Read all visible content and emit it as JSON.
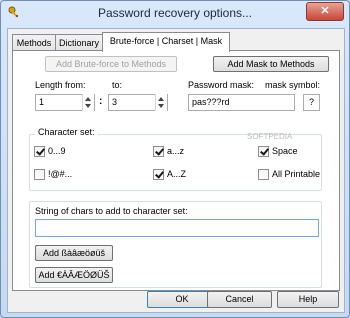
{
  "window": {
    "title": "Password recovery options..."
  },
  "tabs": [
    {
      "label": "Methods"
    },
    {
      "label": "Dictionary"
    },
    {
      "label": "Brute-force | Charset | Mask"
    }
  ],
  "buttons": {
    "add_bruteforce": "Add Brute-force to Methods",
    "add_mask": "Add Mask to Methods",
    "add_lower_special": "Add ßàâæöøüš",
    "add_upper_special": "Add €ÀÂÆÖØÜŠ",
    "ok": "OK",
    "cancel": "Cancel",
    "help": "Help"
  },
  "length": {
    "from_label": "Length from:",
    "to_label": "to:",
    "from_value": "1",
    "to_value": "3"
  },
  "mask": {
    "label": "Password mask:",
    "value": "pas???rd",
    "symbol_label": "mask symbol:",
    "symbol_value": "?"
  },
  "charset": {
    "group_label": "Character set:",
    "options": [
      {
        "label": "0...9",
        "checked": true
      },
      {
        "label": "a...z",
        "checked": true
      },
      {
        "label": "Space",
        "checked": true
      },
      {
        "label": "!@#...",
        "checked": false
      },
      {
        "label": "A...Z",
        "checked": true
      },
      {
        "label": "All Printable",
        "checked": false
      }
    ]
  },
  "custom_string": {
    "label": "String of chars to add to character set:",
    "value": ""
  },
  "watermark": "SOFTPEDIA"
}
